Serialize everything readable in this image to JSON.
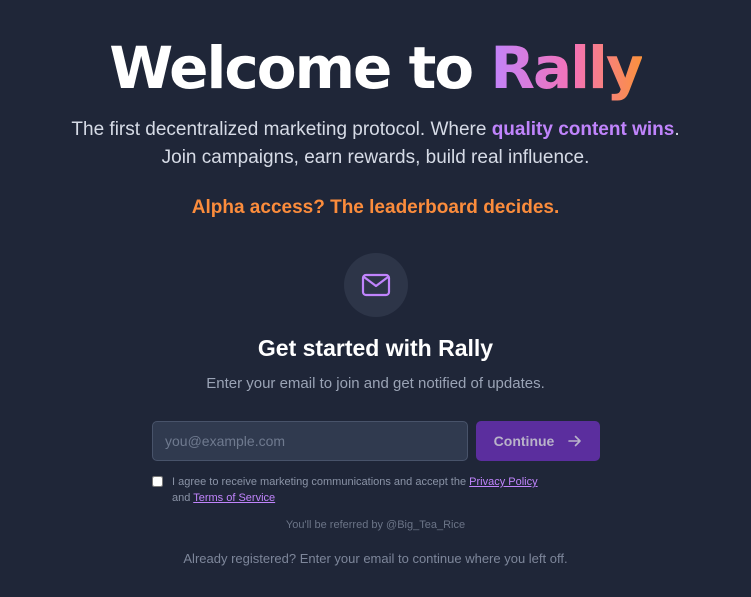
{
  "hero": {
    "title_prefix": "Welcome to ",
    "title_brand": "Rally",
    "tagline_part1": "The first decentralized marketing protocol. Where ",
    "tagline_highlight": "quality content wins",
    "tagline_part2": ".",
    "tagline_line2": "Join campaigns, earn rewards, build real influence.",
    "alpha_notice": "Alpha access? The leaderboard decides."
  },
  "signup": {
    "icon": "mail-icon",
    "title": "Get started with Rally",
    "subtitle": "Enter your email to join and get notified of updates.",
    "email_placeholder": "you@example.com",
    "email_value": "",
    "continue_label": "Continue",
    "continue_icon": "arrow-right-icon",
    "consent_prefix": "I agree to receive marketing communications and accept the ",
    "privacy_link": "Privacy Policy",
    "consent_and": " and ",
    "terms_link": "Terms of Service",
    "consent_checked": false,
    "referral": "You'll be referred by @Big_Tea_Rice",
    "already_registered": "Already registered? Enter your email to continue where you left off."
  },
  "colors": {
    "background": "#1f2638",
    "brand_gradient": [
      "#c084fc",
      "#f472b6",
      "#fb923c"
    ],
    "highlight": "#c084fc",
    "alpha": "#fb8c3c",
    "button": "#5b2e9e"
  }
}
